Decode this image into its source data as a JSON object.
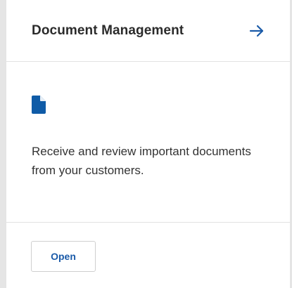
{
  "card": {
    "title": "Document Management",
    "arrow_icon": "arrow-right-icon",
    "doc_icon": "document-icon",
    "description": "Receive and review important documents from your customers.",
    "open_label": "Open"
  },
  "colors": {
    "accent": "#1a5aa8",
    "icon_blue": "#0f5ba7",
    "title_text": "#2b2b2b",
    "body_text": "#333333"
  }
}
